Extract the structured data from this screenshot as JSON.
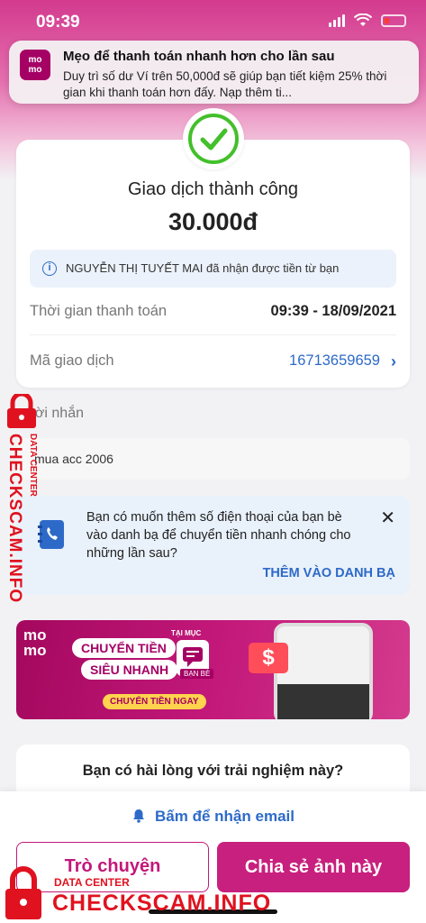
{
  "status_bar": {
    "time": "09:39"
  },
  "notification": {
    "logo": "mo mo",
    "title": "Mẹo để thanh toán nhanh hơn cho lần sau",
    "body": "Duy trì số dư Ví trên 50,000đ sẽ giúp bạn tiết kiệm 25% thời gian khi thanh toán hơn đấy. Nạp thêm ti..."
  },
  "transaction": {
    "status": "Giao dịch thành công",
    "amount": "30.000đ",
    "info": "NGUYỄN THỊ TUYẾT MAI đã nhận được tiền từ bạn",
    "time_label": "Thời gian thanh toán",
    "time_value": "09:39 - 18/09/2021",
    "id_label": "Mã giao dịch",
    "id_value": "16713659659"
  },
  "message": {
    "label": "Lời nhắn",
    "text": "mua acc 2006"
  },
  "contact_prompt": {
    "text": "Bạn có muốn thêm số điện thoại của bạn bè vào danh bạ để chuyển tiền nhanh chóng cho những lần sau?",
    "cta": "THÊM VÀO DANH BẠ"
  },
  "banner": {
    "logo": "mo mo",
    "line1": "CHUYỂN TIỀN",
    "line2": "SIÊU NHANH",
    "tag": "TẠI MỤC",
    "friends": "BẠN BÈ",
    "cta": "CHUYỂN TIỀN NGAY"
  },
  "survey": {
    "question": "Bạn có hài lòng với trải nghiệm này?"
  },
  "bottom": {
    "email": "Bấm để nhận email",
    "chat": "Trò chuyện",
    "share": "Chia sẻ ảnh này"
  },
  "watermark": {
    "brand": "CHECKSCAM.INFO",
    "sub": "DATA CENTER"
  },
  "colors": {
    "brand": "#a50064",
    "accent": "#c8207e",
    "link": "#2d6ac8",
    "success": "#43c02b",
    "watermark": "#e0121f"
  }
}
